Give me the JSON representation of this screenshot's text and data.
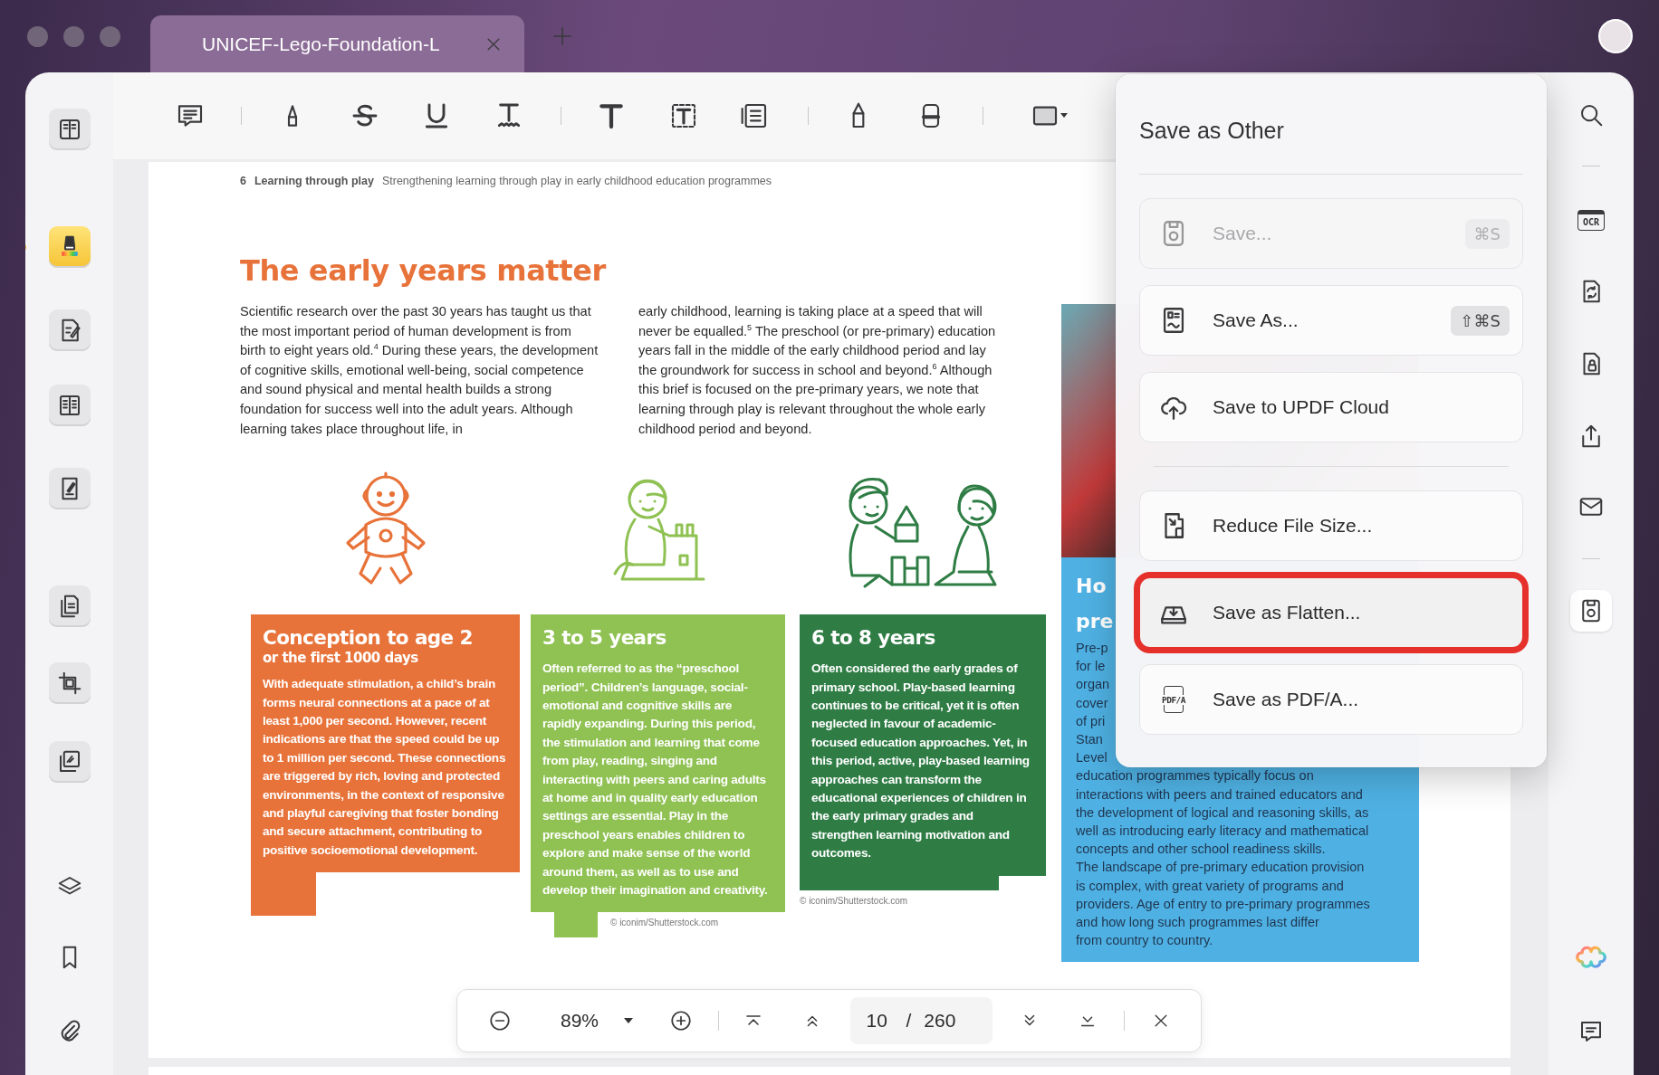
{
  "window": {
    "tab_title": "UNICEF-Lego-Foundation-L"
  },
  "left_sidebar": {
    "items": [
      {
        "selected": false
      },
      {
        "selected": true
      },
      {
        "selected": false
      },
      {
        "selected": false
      },
      {
        "selected": false
      },
      {
        "selected": false
      },
      {
        "selected": false
      },
      {
        "selected": false
      },
      {
        "selected": false
      },
      {
        "selected": false
      },
      {
        "selected": false
      }
    ]
  },
  "document": {
    "page_number": "6",
    "running_title": "Learning through play",
    "running_subtitle": "Strengthening learning through play in early childhood education programmes",
    "heading": "The early years matter",
    "columns": [
      "Scientific research over the past 30 years has taught us that the most important period of human development is from birth to eight years old.$^{4}$ During these years, the development of cognitive skills, emotional well-being, social competence and sound physical and mental health builds a strong foundation for success well into the adult years. Although learning takes place throughout life, in",
      "early childhood, learning is taking place at a speed that will never be equalled.$^{5}$ The preschool (or pre-primary) education years fall in the middle of the early childhood period and lay the groundwork for success in school and beyond.$^{6}$ Although this brief is focused on the pre-primary years, we note that learning through play is relevant throughout the whole early childhood period and beyond."
    ],
    "cards": [
      {
        "title": "Conception to age 2",
        "subtitle": "or the first 1000 days",
        "body": "With adequate stimulation, a child’s brain forms neural connections at a pace of at least 1,000 per second. However, recent indications are that the speed could be up to 1 million per second. These connections are triggered by rich, loving and protected environments, in the context of responsive and playful caregiving that foster bonding and secure attachment, contributing to positive socioemotional development.",
        "color": "#e8733a"
      },
      {
        "title": "3 to 5 years",
        "body": "Often referred to as the “preschool period”. Children’s language, social-emotional and cognitive skills are rapidly expanding. During this period, the stimulation and learning that come from play, reading, singing and interacting with peers and caring adults at home and in quality early education settings are essential. Play in the preschool years enables children to explore and make sense of the world around them, as well as to use and develop their imagination and creativity.",
        "credit": "© iconim/Shutterstock.com",
        "color": "#8fc153"
      },
      {
        "title": "6 to 8 years",
        "body": "Often considered the early grades of primary school. Play-based learning continues to be critical, yet it is often neglected in favour of academic-focused education approaches. Yet, in this period, active, play-based learning approaches can transform the educational experiences of children in the early primary grades and strengthen learning motivation and outcomes.",
        "credit": "© iconim/Shutterstock.com",
        "color": "#2f7d45"
      }
    ],
    "side_card": {
      "heading_lines": [
        "Ho",
        "pre"
      ],
      "lines": [
        "Pre-p",
        "for le",
        "organ",
        "cover",
        "of pri",
        "Stan",
        "Level",
        "education programmes typically focus on",
        "interactions with peers and trained educators and",
        "the development of logical and reasoning skills, as",
        "well as introducing early literacy and mathematical",
        "concepts and other school readiness skills.",
        "The landscape of pre-primary education provision",
        "is complex, with great variety of programs and",
        "providers. Age of entry to pre-primary programmes",
        "and how long such programmes last differ",
        "from country to country."
      ]
    }
  },
  "save_menu": {
    "title": "Save as Other",
    "groups": [
      [
        {
          "label": "Save...",
          "shortcut": "⌘S",
          "disabled": true,
          "highlighted": false
        },
        {
          "label": "Save As...",
          "shortcut": "⇧⌘S",
          "disabled": false,
          "highlighted": false
        },
        {
          "label": "Save to UPDF Cloud",
          "disabled": false,
          "highlighted": false
        }
      ],
      [
        {
          "label": "Reduce File Size...",
          "disabled": false,
          "highlighted": false
        },
        {
          "label": "Save as Flatten...",
          "disabled": false,
          "highlighted": true
        },
        {
          "label": "Save as PDF/A...",
          "icon_text": "PDF/A",
          "disabled": false,
          "highlighted": false
        }
      ]
    ]
  },
  "right_sidebar": {
    "ocr_icon_text": "OCR",
    "items": [
      {
        "selected": false
      },
      {
        "selected": false
      },
      {
        "selected": false
      },
      {
        "selected": false
      },
      {
        "selected": false
      },
      {
        "selected": false
      },
      {
        "selected": true
      },
      {
        "selected": false
      },
      {
        "selected": false
      }
    ]
  },
  "zoom_bar": {
    "zoom": "89%",
    "page": "10",
    "separator": "/",
    "total": "260"
  }
}
